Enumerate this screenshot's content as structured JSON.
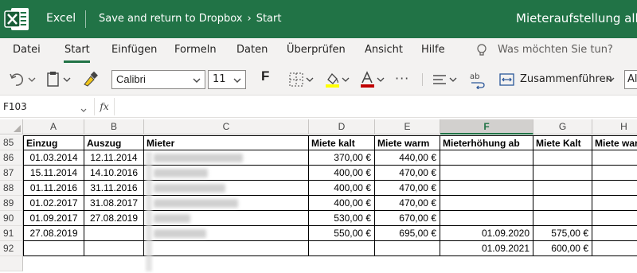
{
  "app": {
    "name": "Excel",
    "breadcrumb_save": "Save and return to Dropbox",
    "breadcrumb_sep": "›",
    "breadcrumb_page": "Start",
    "document_title": "Mieteraufstellung alle",
    "brand_color": "#217346"
  },
  "menu": {
    "tabs": [
      "Datei",
      "Start",
      "Einfügen",
      "Formeln",
      "Daten",
      "Überprüfen",
      "Ansicht",
      "Hilfe"
    ],
    "active": "Start",
    "tell_me": "Was möchten Sie tun?"
  },
  "ribbon": {
    "font_name": "Calibri",
    "font_size": "11",
    "bold_label": "F",
    "more_label": "···",
    "merge_label": "Zusammenführen",
    "style_partial": "Al",
    "icons": [
      "undo-icon",
      "paste-icon",
      "format-painter-icon",
      "borders-icon",
      "fill-color-icon",
      "font-color-icon",
      "align-icon",
      "wrap-text-icon",
      "merge-icon"
    ],
    "fill_color": "#ffff00",
    "font_color": "#c00000"
  },
  "formula_bar": {
    "name_box": "F103",
    "fx_label": "fx",
    "formula": ""
  },
  "grid": {
    "columns": [
      "A",
      "B",
      "C",
      "D",
      "E",
      "F",
      "G",
      "H"
    ],
    "selected_column": "F",
    "rows": [
      "85",
      "86",
      "87",
      "88",
      "89",
      "90",
      "91",
      "92",
      ""
    ],
    "header": [
      "Einzug",
      "Auszug",
      "Mieter",
      "Miete kalt",
      "Miete warm",
      "Mieterhöhung ab",
      "Miete Kalt",
      "Miete warm"
    ],
    "data": [
      [
        "01.03.2014",
        "12.11.2014",
        "",
        "370,00 €",
        "440,00 €",
        "",
        "",
        ""
      ],
      [
        "15.11.2014",
        "14.10.2016",
        "",
        "400,00 €",
        "470,00 €",
        "",
        "",
        ""
      ],
      [
        "01.11.2016",
        "31.11.2016",
        "",
        "400,00 €",
        "470,00 €",
        "",
        "",
        ""
      ],
      [
        "01.02.2017",
        "31.08.2017",
        "",
        "400,00 €",
        "470,00 €",
        "",
        "",
        ""
      ],
      [
        "01.09.2017",
        "27.08.2019",
        "",
        "530,00 €",
        "670,00 €",
        "",
        "",
        ""
      ],
      [
        "27.08.2019",
        "",
        "",
        "550,00 €",
        "695,00 €",
        "01.09.2020",
        "575,00 €",
        ""
      ],
      [
        "",
        "",
        "",
        "",
        "",
        "01.09.2021",
        "600,00 €",
        ""
      ]
    ]
  }
}
